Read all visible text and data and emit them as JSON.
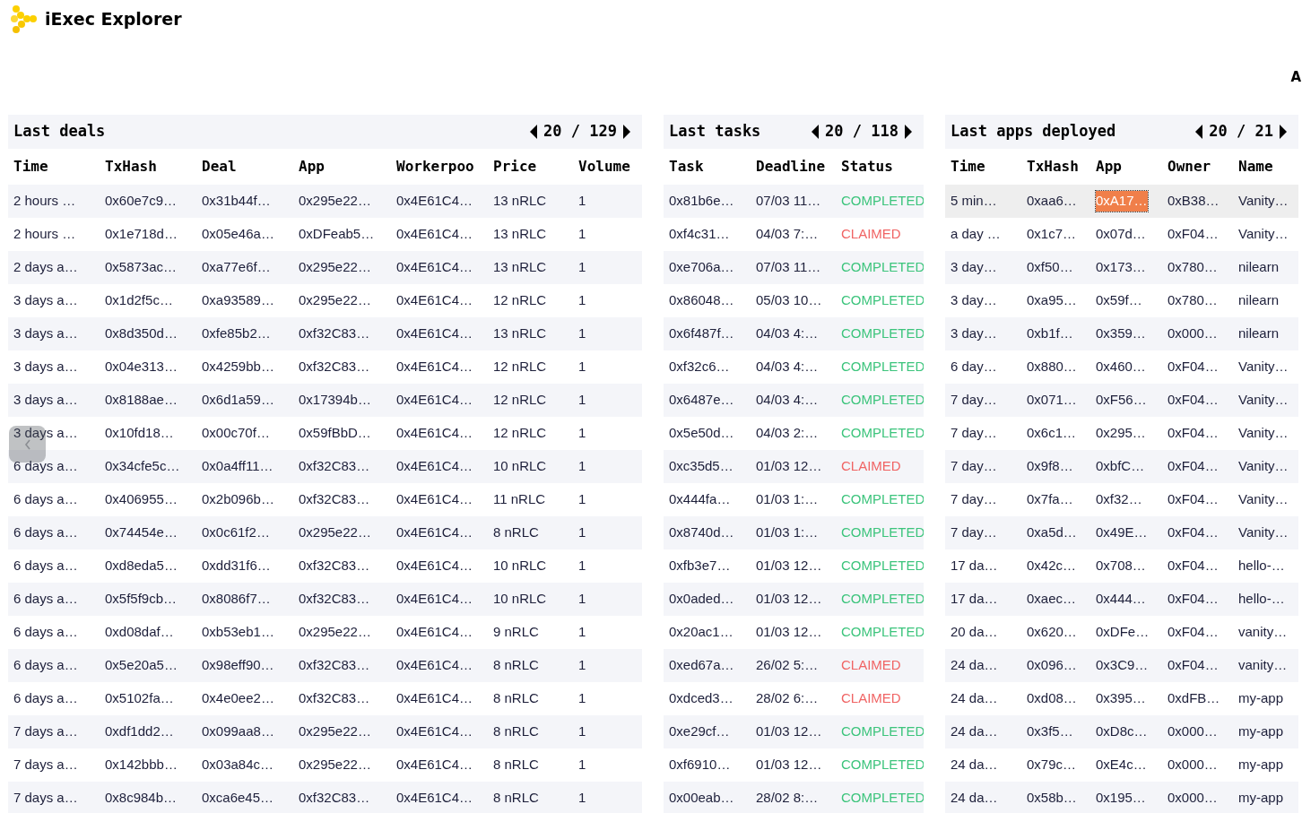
{
  "header": {
    "title": "iExec Explorer",
    "nav_text": "A"
  },
  "panels": [
    {
      "kind": "deals",
      "title": "Last deals",
      "pagination": "20 / 129",
      "columns": [
        "Time",
        "TxHash",
        "Deal",
        "App",
        "Workerpoo",
        "Price",
        "Volume"
      ],
      "rows": [
        {
          "cells": [
            "2 hours …",
            "0x60e7c9…",
            "0x31b44f…",
            "0x295e22…",
            "0x4E61C4…",
            "13 nRLC",
            "1"
          ]
        },
        {
          "cells": [
            "2 hours …",
            "0x1e718d…",
            "0x05e46a…",
            "0xDFeab5…",
            "0x4E61C4…",
            "13 nRLC",
            "1"
          ]
        },
        {
          "cells": [
            "2 days a…",
            "0x5873ac…",
            "0xa77e6f…",
            "0x295e22…",
            "0x4E61C4…",
            "13 nRLC",
            "1"
          ]
        },
        {
          "cells": [
            "3 days a…",
            "0x1d2f5c…",
            "0xa93589…",
            "0x295e22…",
            "0x4E61C4…",
            "12 nRLC",
            "1"
          ]
        },
        {
          "cells": [
            "3 days a…",
            "0x8d350d…",
            "0xfe85b2…",
            "0xf32C83…",
            "0x4E61C4…",
            "13 nRLC",
            "1"
          ]
        },
        {
          "cells": [
            "3 days a…",
            "0x04e313…",
            "0x4259bb…",
            "0xf32C83…",
            "0x4E61C4…",
            "12 nRLC",
            "1"
          ]
        },
        {
          "cells": [
            "3 days a…",
            "0x8188ae…",
            "0x6d1a59…",
            "0x17394b…",
            "0x4E61C4…",
            "12 nRLC",
            "1"
          ]
        },
        {
          "cells": [
            "3 days a…",
            "0x10fd18…",
            "0x00c70f…",
            "0x59fBbD…",
            "0x4E61C4…",
            "12 nRLC",
            "1"
          ]
        },
        {
          "cells": [
            "6 days a…",
            "0x34cfe5c…",
            "0x0a4ff11…",
            "0xf32C83…",
            "0x4E61C4…",
            "10 nRLC",
            "1"
          ]
        },
        {
          "cells": [
            "6 days a…",
            "0x406955…",
            "0x2b096b…",
            "0xf32C83…",
            "0x4E61C4…",
            "11 nRLC",
            "1"
          ]
        },
        {
          "cells": [
            "6 days a…",
            "0x74454e…",
            "0x0c61f2…",
            "0x295e22…",
            "0x4E61C4…",
            "8 nRLC",
            "1"
          ]
        },
        {
          "cells": [
            "6 days a…",
            "0xd8eda5…",
            "0xdd31f6…",
            "0xf32C83…",
            "0x4E61C4…",
            "10 nRLC",
            "1"
          ]
        },
        {
          "cells": [
            "6 days a…",
            "0x5f5f9cb…",
            "0x8086f7…",
            "0xf32C83…",
            "0x4E61C4…",
            "10 nRLC",
            "1"
          ]
        },
        {
          "cells": [
            "6 days a…",
            "0xd08daf…",
            "0xb53eb1…",
            "0x295e22…",
            "0x4E61C4…",
            "9 nRLC",
            "1"
          ]
        },
        {
          "cells": [
            "6 days a…",
            "0x5e20a5…",
            "0x98eff90…",
            "0xf32C83…",
            "0x4E61C4…",
            "8 nRLC",
            "1"
          ]
        },
        {
          "cells": [
            "6 days a…",
            "0x5102fa…",
            "0x4e0ee2…",
            "0xf32C83…",
            "0x4E61C4…",
            "8 nRLC",
            "1"
          ]
        },
        {
          "cells": [
            "7 days a…",
            "0xdf1dd2…",
            "0x099aa8…",
            "0x295e22…",
            "0x4E61C4…",
            "8 nRLC",
            "1"
          ]
        },
        {
          "cells": [
            "7 days a…",
            "0x142bbb…",
            "0x03a84c…",
            "0x295e22…",
            "0x4E61C4…",
            "8 nRLC",
            "1"
          ]
        },
        {
          "cells": [
            "7 days a…",
            "0x8c984b…",
            "0xca6e45…",
            "0xf32C83…",
            "0x4E61C4…",
            "8 nRLC",
            "1"
          ]
        }
      ]
    },
    {
      "kind": "tasks",
      "title": "Last tasks",
      "pagination": "20 / 118",
      "columns": [
        "Task",
        "Deadline",
        "Status"
      ],
      "rows": [
        {
          "cells": [
            "0x81b6e…",
            "07/03 11…",
            "COMPLETED"
          ],
          "color": "#3cc47c"
        },
        {
          "cells": [
            "0xf4c31…",
            "04/03 7:…",
            "CLAIMED"
          ],
          "color": "#f06464"
        },
        {
          "cells": [
            "0xe706a…",
            "07/03 11…",
            "COMPLETED"
          ],
          "color": "#3cc47c"
        },
        {
          "cells": [
            "0x86048…",
            "05/03 10…",
            "COMPLETED"
          ],
          "color": "#3cc47c"
        },
        {
          "cells": [
            "0x6f487f…",
            "04/03 4:…",
            "COMPLETED"
          ],
          "color": "#3cc47c"
        },
        {
          "cells": [
            "0xf32c6…",
            "04/03 4:…",
            "COMPLETED"
          ],
          "color": "#3cc47c"
        },
        {
          "cells": [
            "0x6487e…",
            "04/03 4:…",
            "COMPLETED"
          ],
          "color": "#3cc47c"
        },
        {
          "cells": [
            "0x5e50d…",
            "04/03 2:…",
            "COMPLETED"
          ],
          "color": "#3cc47c"
        },
        {
          "cells": [
            "0xc35d5…",
            "01/03 12…",
            "CLAIMED"
          ],
          "color": "#f06464"
        },
        {
          "cells": [
            "0x444fa…",
            "01/03 1:…",
            "COMPLETED"
          ],
          "color": "#3cc47c"
        },
        {
          "cells": [
            "0x8740d…",
            "01/03 1:…",
            "COMPLETED"
          ],
          "color": "#3cc47c"
        },
        {
          "cells": [
            "0xfb3e7…",
            "01/03 12…",
            "COMPLETED"
          ],
          "color": "#3cc47c"
        },
        {
          "cells": [
            "0x0aded…",
            "01/03 12…",
            "COMPLETED"
          ],
          "color": "#3cc47c"
        },
        {
          "cells": [
            "0x20ac1…",
            "01/03 12…",
            "COMPLETED"
          ],
          "color": "#3cc47c"
        },
        {
          "cells": [
            "0xed67a…",
            "26/02 5:…",
            "CLAIMED"
          ],
          "color": "#f06464"
        },
        {
          "cells": [
            "0xdced3…",
            "28/02 6:…",
            "CLAIMED"
          ],
          "color": "#f06464"
        },
        {
          "cells": [
            "0xe29cf…",
            "01/03 12…",
            "COMPLETED"
          ],
          "color": "#3cc47c"
        },
        {
          "cells": [
            "0xf6910…",
            "01/03 12…",
            "COMPLETED"
          ],
          "color": "#3cc47c"
        },
        {
          "cells": [
            "0x00eab…",
            "28/02 8:…",
            "COMPLETED"
          ],
          "color": "#3cc47c"
        }
      ]
    },
    {
      "kind": "apps",
      "title": "Last apps deployed",
      "pagination": "20 / 21",
      "columns": [
        "Time",
        "TxHash",
        "App",
        "Owner",
        "Name"
      ],
      "rows": [
        {
          "cells": [
            "5 min…",
            "0xaa6…",
            "0xA17…",
            "0xB38…",
            "Vanity…"
          ],
          "selected": true
        },
        {
          "cells": [
            "a day …",
            "0x1c7…",
            "0x07d…",
            "0xF04…",
            "Vanity…"
          ],
          "selected": false
        },
        {
          "cells": [
            "3 day…",
            "0xf50…",
            "0x173…",
            "0x780…",
            "nilearn"
          ],
          "selected": false
        },
        {
          "cells": [
            "3 day…",
            "0xa95…",
            "0x59f…",
            "0x780…",
            "nilearn"
          ],
          "selected": false
        },
        {
          "cells": [
            "3 day…",
            "0xb1f…",
            "0x359…",
            "0x000…",
            "nilearn"
          ],
          "selected": false
        },
        {
          "cells": [
            "6 day…",
            "0x880…",
            "0x460…",
            "0xF04…",
            "Vanity…"
          ],
          "selected": false
        },
        {
          "cells": [
            "7 day…",
            "0x071…",
            "0xF56…",
            "0xF04…",
            "Vanity…"
          ],
          "selected": false
        },
        {
          "cells": [
            "7 day…",
            "0x6c1…",
            "0x295…",
            "0xF04…",
            "Vanity…"
          ],
          "selected": false
        },
        {
          "cells": [
            "7 day…",
            "0x9f8…",
            "0xbfC…",
            "0xF04…",
            "Vanity…"
          ],
          "selected": false
        },
        {
          "cells": [
            "7 day…",
            "0x7fa…",
            "0xf32…",
            "0xF04…",
            "Vanity…"
          ],
          "selected": false
        },
        {
          "cells": [
            "7 day…",
            "0xa5d…",
            "0x49E…",
            "0xF04…",
            "Vanity…"
          ],
          "selected": false
        },
        {
          "cells": [
            "17 da…",
            "0x42c…",
            "0x708…",
            "0xF04…",
            "hello-…"
          ],
          "selected": false
        },
        {
          "cells": [
            "17 da…",
            "0xaec…",
            "0x444…",
            "0xF04…",
            "hello-…"
          ],
          "selected": false
        },
        {
          "cells": [
            "20 da…",
            "0x620…",
            "0xDFe…",
            "0xF04…",
            "vanity…"
          ],
          "selected": false
        },
        {
          "cells": [
            "24 da…",
            "0x096…",
            "0x3C9…",
            "0xF04…",
            "vanity…"
          ],
          "selected": false
        },
        {
          "cells": [
            "24 da…",
            "0xd08…",
            "0x395…",
            "0xdFB…",
            "my-app"
          ],
          "selected": false
        },
        {
          "cells": [
            "24 da…",
            "0x3f5…",
            "0xD8c…",
            "0x000…",
            "my-app"
          ],
          "selected": false
        },
        {
          "cells": [
            "24 da…",
            "0x79c…",
            "0xE4c…",
            "0x000…",
            "my-app"
          ],
          "selected": false
        },
        {
          "cells": [
            "24 da…",
            "0x58b…",
            "0x195…",
            "0x000…",
            "my-app"
          ],
          "selected": false
        }
      ]
    }
  ]
}
